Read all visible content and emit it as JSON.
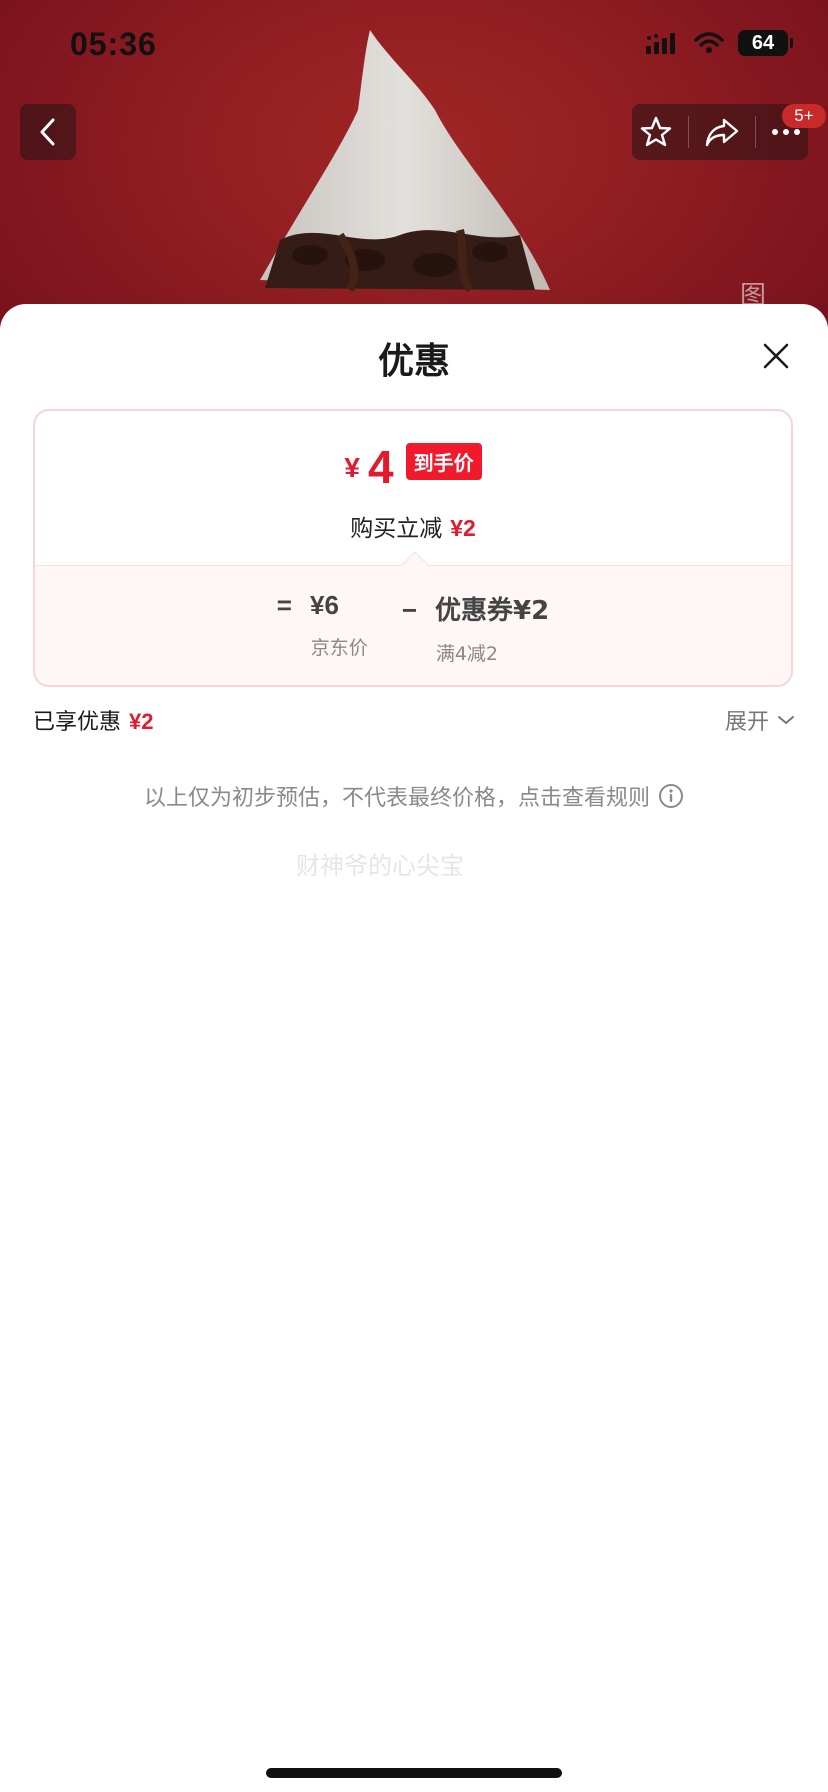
{
  "status_bar": {
    "time": "05:36",
    "battery": "64"
  },
  "nav": {
    "back_icon": "chevron-left-icon",
    "favorite_icon": "star-icon",
    "share_icon": "share-icon",
    "more_icon": "more-dots-icon",
    "badge": "5+"
  },
  "background_page": {
    "side_text": "图"
  },
  "sheet": {
    "title": "优惠",
    "close_icon": "close-icon",
    "card": {
      "currency": "¥",
      "final_price": "4",
      "final_price_tag": "到手价",
      "reduce_label": "购买立减",
      "reduce_amount": "¥2",
      "formula": {
        "equals": "=",
        "base_price": "¥6",
        "base_label": "京东价",
        "minus": "−",
        "coupon_text": "优惠券¥2",
        "coupon_rule": "满4减2"
      }
    },
    "enjoyed_label": "已享优惠",
    "enjoyed_amount": "¥2",
    "expand_label": "展开",
    "disclaimer": "以上仅为初步预估，不代表最终价格，点击查看规则",
    "watermark": "财神爷的心尖宝"
  },
  "colors": {
    "accent_red": "#e3192d",
    "tag_red": "#f01a2c",
    "card_border": "#f6d4d8"
  }
}
